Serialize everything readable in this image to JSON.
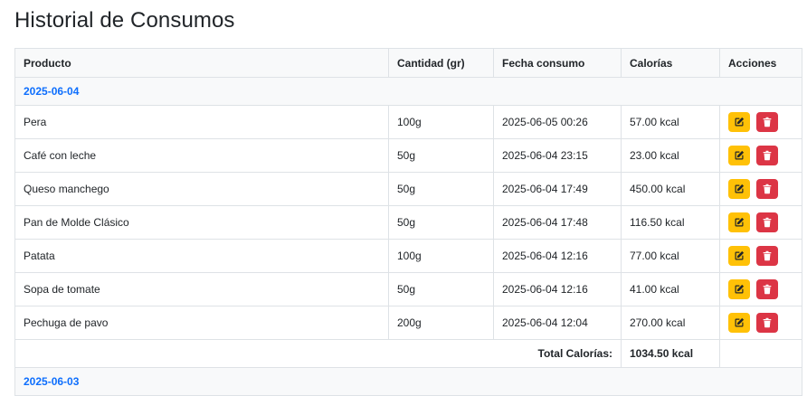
{
  "page": {
    "title": "Historial de Consumos"
  },
  "table": {
    "headers": [
      "Producto",
      "Cantidad (gr)",
      "Fecha consumo",
      "Calorías",
      "Acciones"
    ],
    "groups": [
      {
        "date": "2025-06-04",
        "rows": [
          {
            "producto": "Pera",
            "cantidad": "100g",
            "fecha": "2025-06-05 00:26",
            "calorias": "57.00 kcal"
          },
          {
            "producto": "Café con leche",
            "cantidad": "50g",
            "fecha": "2025-06-04 23:15",
            "calorias": "23.00 kcal"
          },
          {
            "producto": "Queso manchego",
            "cantidad": "50g",
            "fecha": "2025-06-04 17:49",
            "calorias": "450.00 kcal"
          },
          {
            "producto": "Pan de Molde Clásico",
            "cantidad": "50g",
            "fecha": "2025-06-04 17:48",
            "calorias": "116.50 kcal"
          },
          {
            "producto": "Patata",
            "cantidad": "100g",
            "fecha": "2025-06-04 12:16",
            "calorias": "77.00 kcal"
          },
          {
            "producto": "Sopa de tomate",
            "cantidad": "50g",
            "fecha": "2025-06-04 12:16",
            "calorias": "41.00 kcal"
          },
          {
            "producto": "Pechuga de pavo",
            "cantidad": "200g",
            "fecha": "2025-06-04 12:04",
            "calorias": "270.00 kcal"
          }
        ],
        "total_label": "Total Calorías:",
        "total_value": "1034.50 kcal"
      },
      {
        "date": "2025-06-03",
        "rows": []
      }
    ]
  },
  "icons": {
    "edit": "edit-icon",
    "delete": "trash-icon"
  },
  "colors": {
    "edit_button": "#ffc107",
    "delete_button": "#dc3545",
    "date_text": "#0d6efd",
    "header_bg": "#f8f9fa",
    "border": "#dee2e6"
  }
}
